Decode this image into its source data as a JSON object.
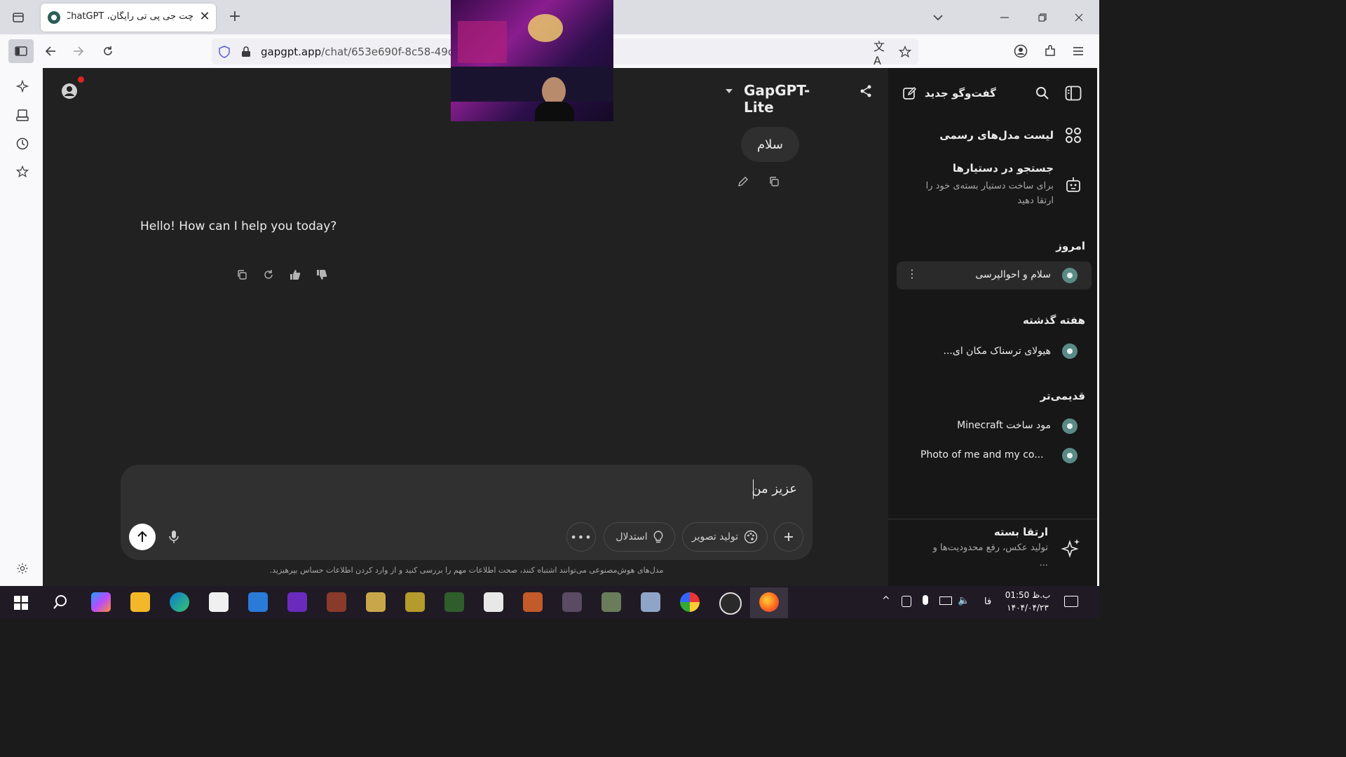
{
  "browser": {
    "tab_title": "چت جی پی تی رایگان، ChatGPT",
    "url_host": "gapgpt.app",
    "url_path": "/chat/653e690f-8c58-49d9-",
    "window_controls": [
      "chevron-down-icon",
      "minimize-icon",
      "restore-icon",
      "close-icon"
    ]
  },
  "header": {
    "model_name": "GapGPT-Lite"
  },
  "conversation": {
    "user_message": "سلام",
    "assistant_message": "Hello! How can I help you today?"
  },
  "composer": {
    "input_text": "عزیز من",
    "image_gen_label": "تولید تصویر",
    "reasoning_label": "استدلال",
    "disclaimer": "مدل‌های هوش‌مصنوعی می‌توانند اشتباه کنند، صحت اطلاعات مهم را بررسی کنید و از وارد کردن اطلاعات حساس بپرهیزید."
  },
  "sidebar": {
    "new_chat_label": "گفت‌وگو جدید",
    "models_list_label": "لیست مدل‌های رسمی",
    "assistants_title": "جستجو در دستیارها",
    "assistants_subtitle": "برای ساخت دستیار بسته‌ی خود را ارتقا دهید",
    "section_today": "امروز",
    "today_items": [
      "سلام و احوالپرسی"
    ],
    "section_last_week": "هفته گذشته",
    "last_week_items": [
      "هیولای ترسناک مکان ای..."
    ],
    "section_older": "قدیمی‌تر",
    "older_items": [
      "مود ساخت Minecraft",
      "Photo of me and my co..."
    ],
    "upgrade_title": "ارتقا بسته",
    "upgrade_subtitle": "تولید عکس، رفع محدودیت‌ها و",
    "upgrade_more": "..."
  },
  "taskbar": {
    "time": "01:50 ب.ظ",
    "date": "۱۴۰۴/۰۴/۲۳",
    "language": "فا"
  },
  "colors": {
    "main_bg": "#212121",
    "sidebar_bg": "#171717",
    "composer_bg": "#303030",
    "logo_accent": "#5a8a84"
  }
}
